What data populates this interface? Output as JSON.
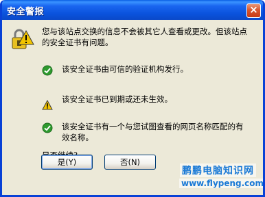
{
  "window": {
    "title": "安全警报",
    "close_label": "×"
  },
  "message": {
    "intro": "您与该站点交换的信息不会被其它人查看或更改。但该站点的安全证书有问题。"
  },
  "items": [
    {
      "icon": "check-icon",
      "status": "ok",
      "text": "该安全证书由可信的验证机构发行。"
    },
    {
      "icon": "warning-icon",
      "status": "warning",
      "text": "该安全证书已到期或还未生效。"
    },
    {
      "icon": "check-icon",
      "status": "ok",
      "text": "该安全证书有一个与您试图查看的网页名称匹配的有效名称。"
    }
  ],
  "question": "是否继续?",
  "buttons": {
    "yes_label": "是(Y)",
    "no_label": "否(N)"
  },
  "watermark": {
    "line1": "鹏鹏电脑知识网",
    "line2": "www.flypeng.com"
  },
  "colors": {
    "titlebar": "#0a52dc",
    "dialog_bg": "#ece9d8",
    "ok_icon": "#2e9a2e",
    "warning_icon": "#f2c400",
    "watermark": "#1979d6"
  }
}
